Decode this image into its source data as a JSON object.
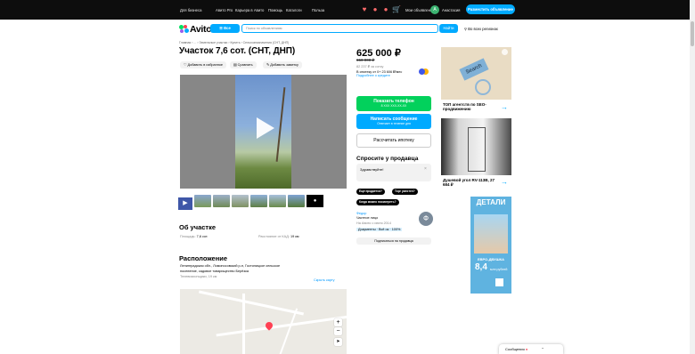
{
  "topbar": {
    "links": [
      "Для бизнеса",
      "Авито Pro",
      "Карьера в Авито",
      "Помощь",
      "Каталоги",
      "Польза"
    ],
    "messages": "Мои объявления",
    "user_initial": "А",
    "user_name": "Анастасия",
    "post_button": "Разместить объявление"
  },
  "header": {
    "logo": "Avito",
    "all_categories": "Все категории",
    "search_placeholder": "Поиск по объявлениям",
    "find_button": "Найти",
    "region": "Во всех регионах"
  },
  "listing": {
    "breadcrumbs": "Главная › ... › Земельные участки › Купить › Сельхозназначения (СНТ, ДНП)",
    "title": "Участок 7,6 сот. (СНТ, ДНП)",
    "actions": [
      "Добавить в избранное",
      "Сравнить",
      "Добавить заметку"
    ],
    "about_title": "Об участке",
    "area_label": "Площадь:",
    "area_value": "7,6 сот.",
    "distance_label": "Расстояние от КАД:",
    "distance_value": "19 км",
    "location_title": "Расположение",
    "address_line1": "Ленинградская обл., Ломоносовский р-н, Гостилицкое сельское",
    "address_line2": "поселение, садовое товарищество Берёзка",
    "metro": "Телевизионщики, 19 км",
    "hide_map": "Скрыть карту"
  },
  "seller": {
    "price": "625 000 ₽",
    "old_price": "650 000 ₽",
    "per_hundred": "82 237 ₽ за сотку",
    "mortgage": "В ипотеку от 0+ 23 606 ₽/мес",
    "mortgage_link": "Подробнее о кредите",
    "show_phone": "Показать телефон",
    "phone_mask": "8 XXX XXX-XX-XX",
    "write_message": "Написать сообщение",
    "reply_note": "Отвечает в течение дня",
    "calc_mortgage": "Рассчитать ипотеку",
    "ask_title": "Спросите у продавца",
    "greeting": "Здравствуйте!",
    "quick_replies": [
      "Ещё продаётся?",
      "Торг уместен?",
      "Когда можно посмотреть?"
    ],
    "name": "Федор",
    "type": "Частное лицо",
    "since": "На Авито с июня 2014",
    "docs": "Документы · Всё ок · 100%",
    "initial": "Ф",
    "subscribe": "Подписаться на продавца"
  },
  "ads": {
    "ad1_text": "ТОП агентств по SEO-продвижению",
    "ad1_caption": "Search",
    "ad2_text": "Душевой угол RV-113B, 27 684 ₽",
    "ad3_brand": "ДЕТАЛИ",
    "ad3_promo": "ЕВРО-ДВУШКА",
    "ad3_price": "8,4",
    "ad3_price_unit": "млн рублей"
  },
  "bottom": {
    "messages": "Сообщения"
  }
}
